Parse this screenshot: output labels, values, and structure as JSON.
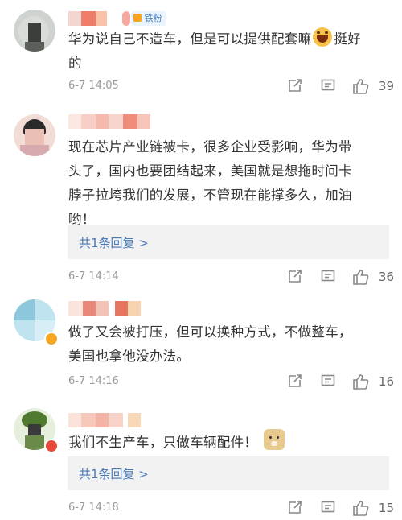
{
  "comments": [
    {
      "content": "华为说自己不造车，但是可以提供配套嘛",
      "content2": "挺好",
      "content3": "的",
      "fan_badge": "铁粉",
      "time": "6-7 14:05",
      "likes": "39",
      "emoji": "laugh-emoji"
    },
    {
      "content_lines": [
        "现在芯片产业链被卡，很多企业受影响，华为带",
        "头了，国内也要团结起来，美国就是想拖时间卡",
        "脖子拉垮我们的发展，不管现在能撑多久，加油",
        "哟！"
      ],
      "reply_text": "共1条回复 >",
      "time": "6-7 14:14",
      "likes": "36"
    },
    {
      "content_lines": [
        "做了又会被打压，但可以换种方式，不做整车，",
        "美国也拿他没办法。"
      ],
      "time": "6-7 14:16",
      "likes": "16"
    },
    {
      "content": "我们不生产车，只做车辆配件！",
      "reply_text": "共1条回复 >",
      "time": "6-7 14:18",
      "likes": "15",
      "emoji": "doge-emoji"
    }
  ],
  "colors": {
    "link": "#4a7bb7",
    "meta": "#999999",
    "reply_bg": "#f2f2f2",
    "vip_badge": "#f6a623"
  }
}
